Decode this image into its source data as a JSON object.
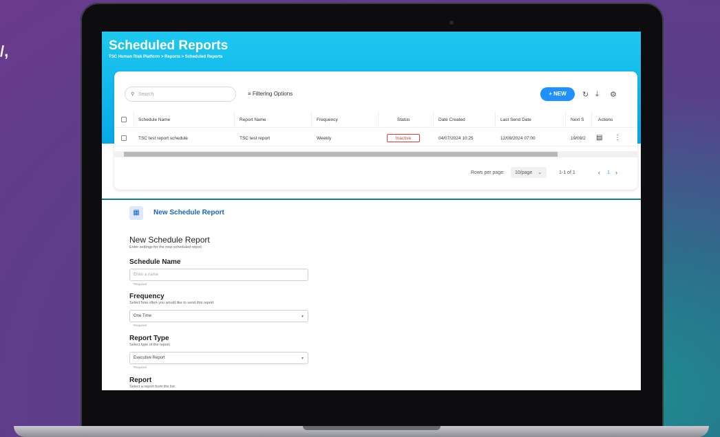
{
  "background": {
    "left_text": "/,"
  },
  "page": {
    "title": "Scheduled Reports",
    "breadcrumb": "TSC Human Risk Platform > Reports > Scheduled Reports"
  },
  "toolbar": {
    "search_placeholder": "Search",
    "filter_label": "Filtering Options",
    "new_label": "+ NEW"
  },
  "table": {
    "columns": [
      "Schedule Name",
      "Report Name",
      "Frequency",
      "Status",
      "Date Created",
      "Last Send Date",
      "Next S",
      "Actions"
    ],
    "rows": [
      {
        "schedule_name": "TSC test report schedule",
        "report_name": "TSC test report",
        "frequency": "Weekly",
        "status": "Inactive",
        "date_created": "04/07/2024 10:25",
        "last_send_date": "12/09/2024 07:00",
        "next_send": "19/09/2"
      }
    ]
  },
  "pagination": {
    "rows_per_page_label": "Rows per page:",
    "rows_per_page_value": "10/page",
    "range": "1-1 of 1",
    "current_page": "1"
  },
  "form": {
    "panel_title": "New Schedule Report",
    "heading": "New Schedule Report",
    "heading_sub": "Enter settings for the new scheduled report",
    "schedule_name": {
      "label": "Schedule Name",
      "placeholder": "Enter a name",
      "required": "*Required"
    },
    "frequency": {
      "label": "Frequency",
      "hint": "Select how often you would like to send this report",
      "value": "One Time",
      "required": "*Required"
    },
    "report_type": {
      "label": "Report Type",
      "hint": "Select type of the report",
      "value": "Executive Report",
      "required": "*Required"
    },
    "report": {
      "label": "Report",
      "hint": "Select a report from the list"
    }
  },
  "colors": {
    "accent": "#1e90ff",
    "header": "#07a9e6",
    "inactive": "#e53935"
  }
}
